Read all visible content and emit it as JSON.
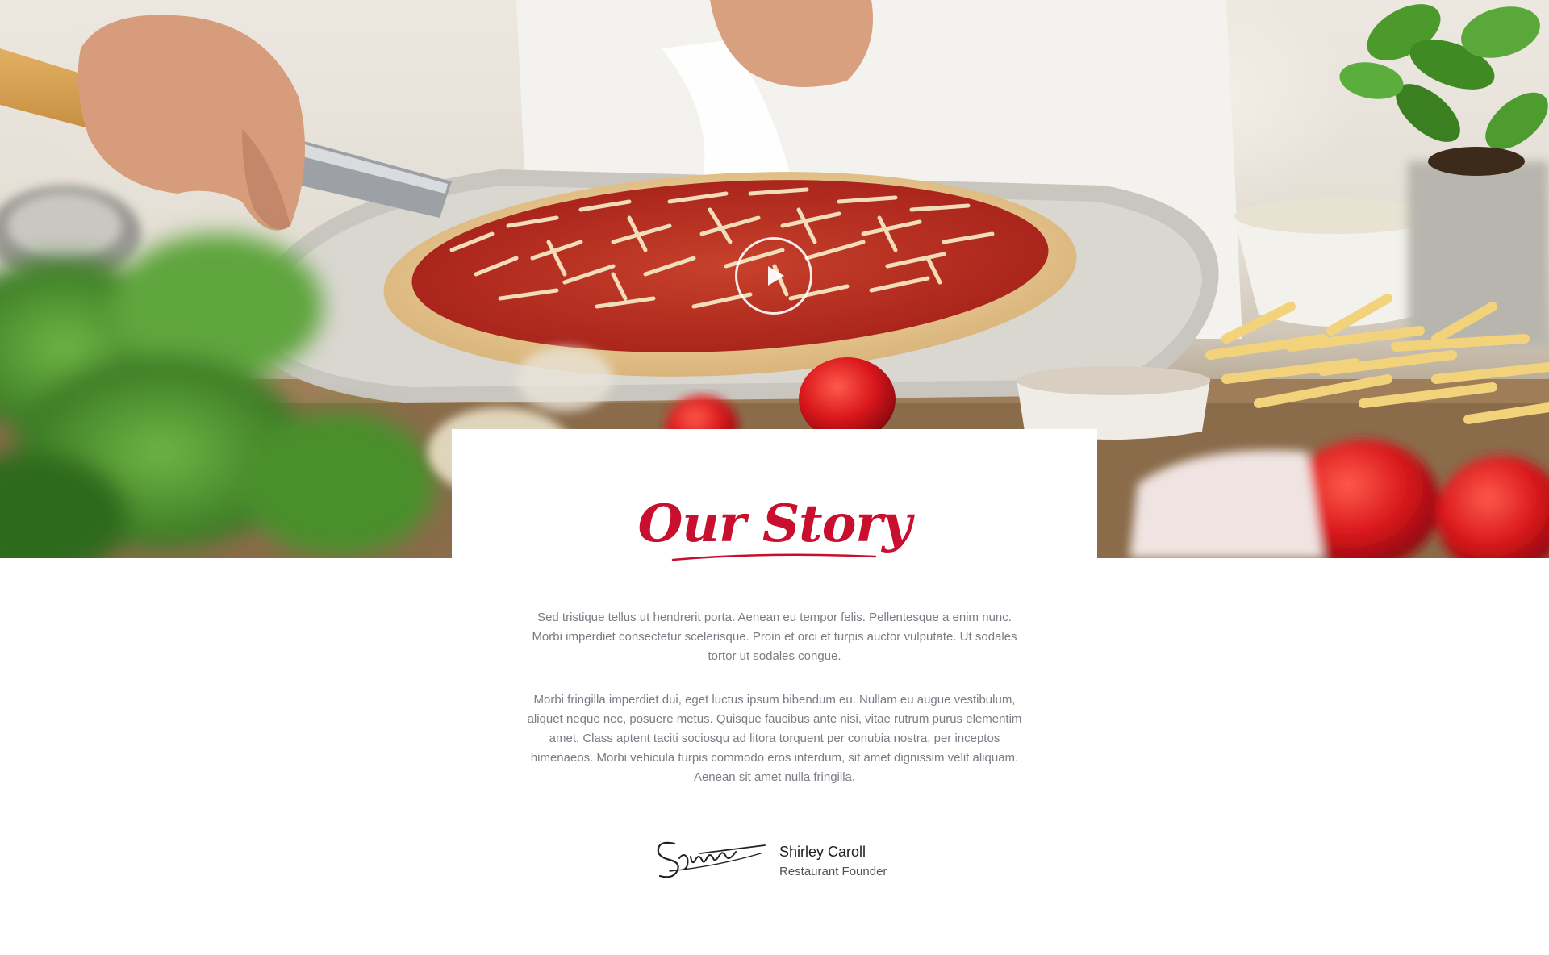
{
  "hero": {
    "image_subject": "chef placing a cheese and tomato pizza on a peel",
    "play_icon": "play-icon"
  },
  "story": {
    "title": "Our Story",
    "paragraphs": [
      "Sed tristique tellus ut hendrerit porta. Aenean eu tempor felis. Pellentesque a enim nunc. Morbi imperdiet consectetur scelerisque. Proin et orci et turpis auctor vulputate. Ut sodales tortor ut sodales congue.",
      "Morbi fringilla imperdiet dui, eget luctus ipsum bibendum eu. Nullam eu augue vestibulum, aliquet neque nec, posuere metus. Quisque faucibus ante nisi, vitae rutrum purus elementim amet. Class aptent taciti sociosqu ad litora torquent per conubia nostra, per inceptos himenaeos. Morbi vehicula turpis commodo eros interdum, sit amet dignissim velit aliquam. Aenean sit amet nulla fringilla."
    ],
    "founder": {
      "name": "Shirley Caroll",
      "role": "Restaurant Founder",
      "signature_icon": "signature"
    }
  },
  "colors": {
    "accent": "#c8102e",
    "body_text": "#7e7a85",
    "background": "#ffffff"
  }
}
